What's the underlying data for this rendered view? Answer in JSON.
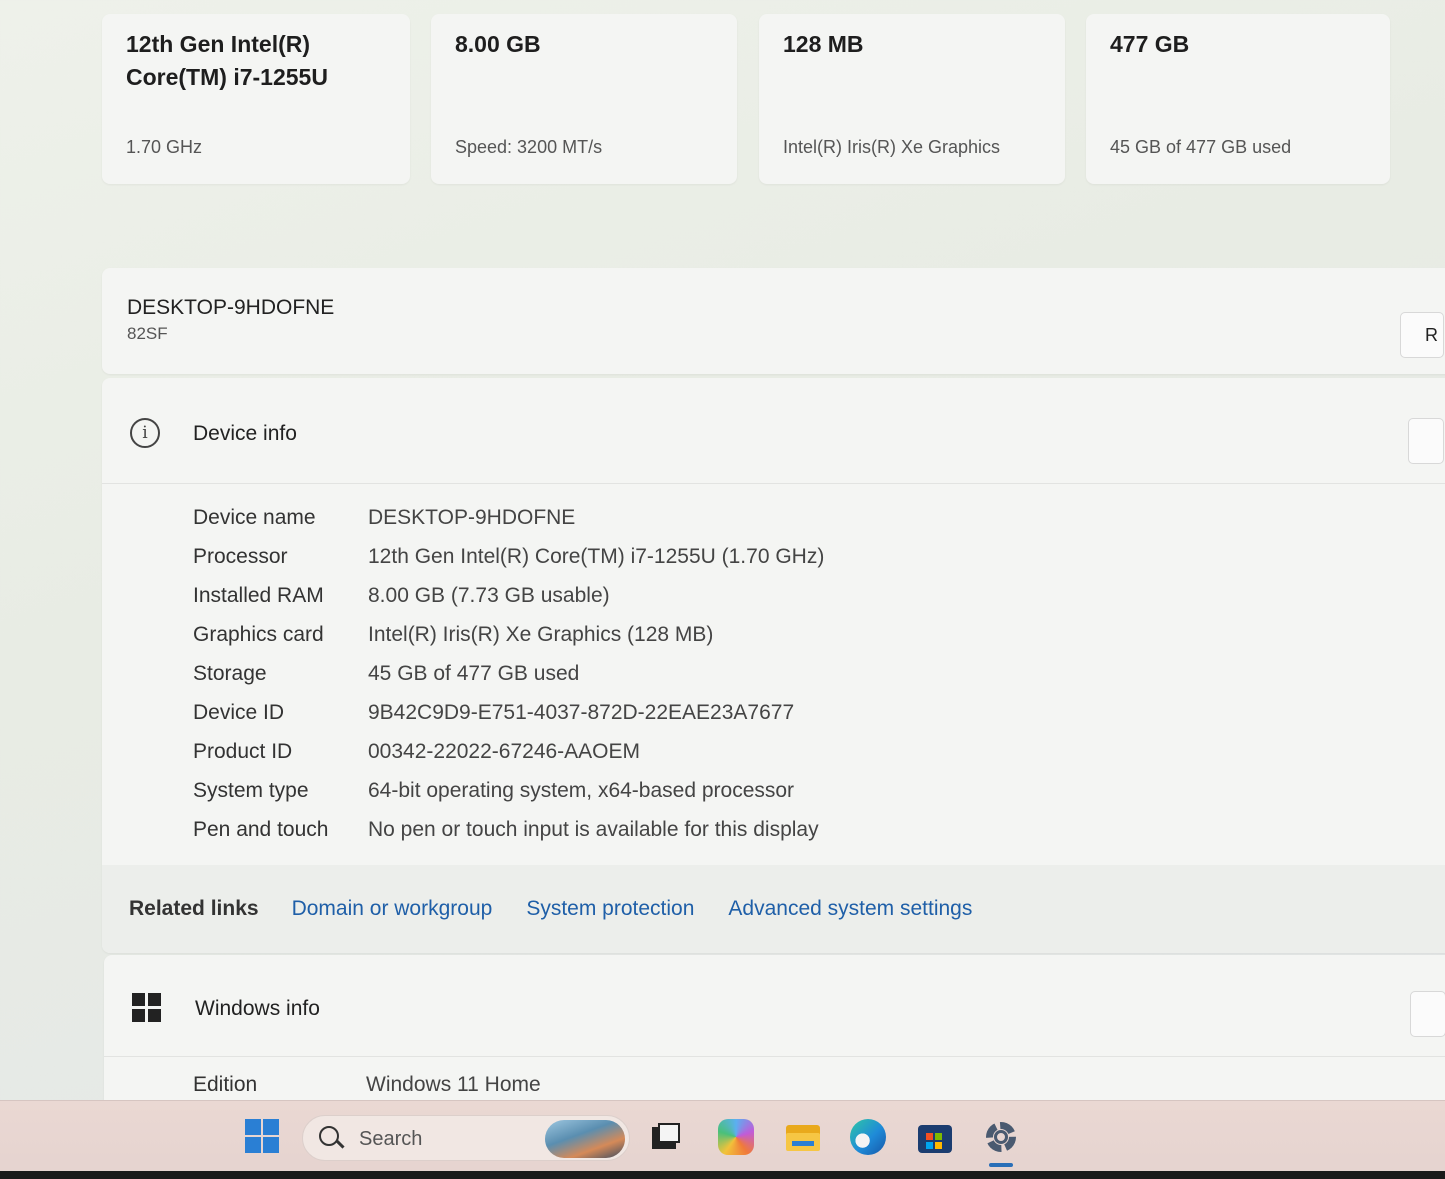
{
  "specs": {
    "cpu": {
      "value": "12th Gen Intel(R) Core(TM) i7-1255U",
      "sub": "1.70 GHz"
    },
    "ram": {
      "value": "8.00 GB",
      "sub": "Speed: 3200 MT/s"
    },
    "gpu": {
      "value": "128 MB",
      "sub": "Intel(R) Iris(R) Xe Graphics"
    },
    "storage": {
      "value": "477 GB",
      "sub": "45 GB of 477 GB used"
    }
  },
  "device_header": {
    "name": "DESKTOP-9HDOFNE",
    "model": "82SF",
    "rename_label": "R"
  },
  "device_info": {
    "title": "Device info",
    "rows": [
      {
        "key": "Device name",
        "value": "DESKTOP-9HDOFNE"
      },
      {
        "key": "Processor",
        "value": "12th Gen Intel(R) Core(TM) i7-1255U (1.70 GHz)"
      },
      {
        "key": "Installed RAM",
        "value": "8.00 GB (7.73 GB usable)"
      },
      {
        "key": "Graphics card",
        "value": "Intel(R) Iris(R) Xe Graphics (128 MB)"
      },
      {
        "key": "Storage",
        "value": "45 GB of 477 GB used"
      },
      {
        "key": "Device ID",
        "value": "9B42C9D9-E751-4037-872D-22EAE23A7677"
      },
      {
        "key": "Product ID",
        "value": "00342-22022-67246-AAOEM"
      },
      {
        "key": "System type",
        "value": "64-bit operating system, x64-based processor"
      },
      {
        "key": "Pen and touch",
        "value": "No pen or touch input is available for this display"
      }
    ]
  },
  "related_links": {
    "label": "Related links",
    "links": [
      "Domain or workgroup",
      "System protection",
      "Advanced system settings"
    ]
  },
  "windows_info": {
    "title": "Windows info",
    "edition_key": "Edition",
    "edition_value": "Windows 11 Home"
  },
  "taskbar": {
    "search_placeholder": "Search",
    "apps": [
      "task-view-icon",
      "copilot-icon",
      "file-explorer-icon",
      "edge-icon",
      "store-icon",
      "settings-icon"
    ]
  },
  "colors": {
    "link": "#1f5fa8",
    "accent": "#2a7fd4"
  }
}
